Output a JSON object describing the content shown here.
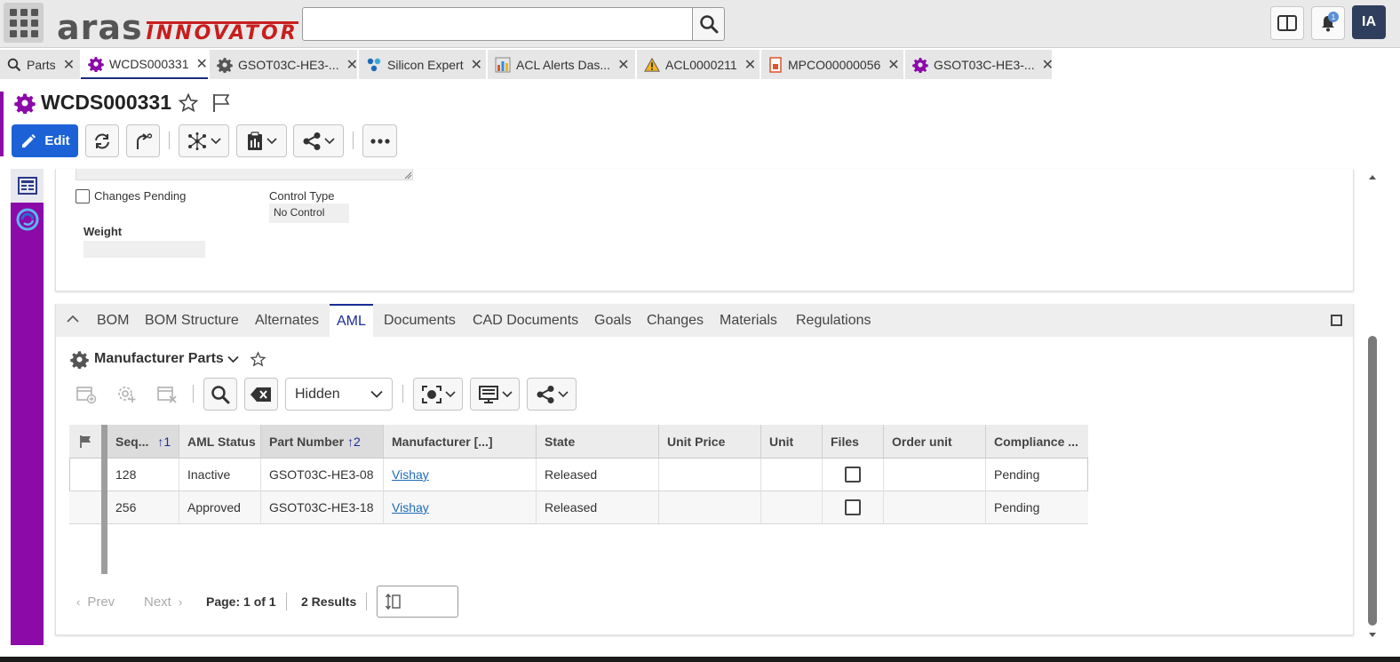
{
  "app": {
    "logo_main": "aras",
    "logo_sub": "INNOVATOR",
    "search_value": "",
    "avatar_initials": "IA",
    "notifications_count": "1"
  },
  "tabs": [
    {
      "label": "Parts",
      "icon": "search-icon"
    },
    {
      "label": "WCDS000331",
      "icon": "gear-icon",
      "active": true
    },
    {
      "label": "GSOT03C-HE3-...",
      "icon": "gear-icon"
    },
    {
      "label": "Silicon Expert",
      "icon": "network-icon"
    },
    {
      "label": "ACL Alerts Das...",
      "icon": "chart-icon"
    },
    {
      "label": "ACL0000211",
      "icon": "warning-icon"
    },
    {
      "label": "MPCO00000056",
      "icon": "document-icon"
    },
    {
      "label": "GSOT03C-HE3-...",
      "icon": "gear-icon"
    }
  ],
  "item": {
    "title": "WCDS000331",
    "edit_label": "Edit"
  },
  "form": {
    "changes_pending_label": "Changes Pending",
    "control_type_label": "Control Type",
    "control_type_value": "No Control",
    "weight_label": "Weight",
    "weight_value": ""
  },
  "relationship_tabs": [
    "BOM",
    "BOM Structure",
    "Alternates",
    "AML",
    "Documents",
    "CAD Documents",
    "Goals",
    "Changes",
    "Materials",
    "Regulations"
  ],
  "grid_panel": {
    "title": "Manufacturer Parts",
    "view_select": "Hidden",
    "columns": {
      "seq": "Seq...",
      "seq_sort": "1",
      "aml_status": "AML Status",
      "part_number": "Part Number",
      "part_sort": "2",
      "manufacturer": "Manufacturer [...]",
      "state": "State",
      "unit_price": "Unit Price",
      "unit": "Unit",
      "files": "Files",
      "order_unit": "Order unit",
      "compliance": "Compliance ..."
    },
    "rows": [
      {
        "seq": "128",
        "aml_status": "Inactive",
        "part_number": "GSOT03C-HE3-08",
        "manufacturer": "Vishay",
        "state": "Released",
        "unit_price": "",
        "unit": "",
        "order_unit": "",
        "compliance": "Pending"
      },
      {
        "seq": "256",
        "aml_status": "Approved",
        "part_number": "GSOT03C-HE3-18",
        "manufacturer": "Vishay",
        "state": "Released",
        "unit_price": "",
        "unit": "",
        "order_unit": "",
        "compliance": "Pending"
      }
    ]
  },
  "pager": {
    "prev": "Prev",
    "next": "Next",
    "page": "Page: 1 of 1",
    "results": "2 Results",
    "page_size": ""
  },
  "colors": {
    "accent_purple": "#8b0aa8",
    "edit_blue": "#1c62d6",
    "link_blue": "#1e6ab8",
    "logo_red": "#c81e1e"
  }
}
